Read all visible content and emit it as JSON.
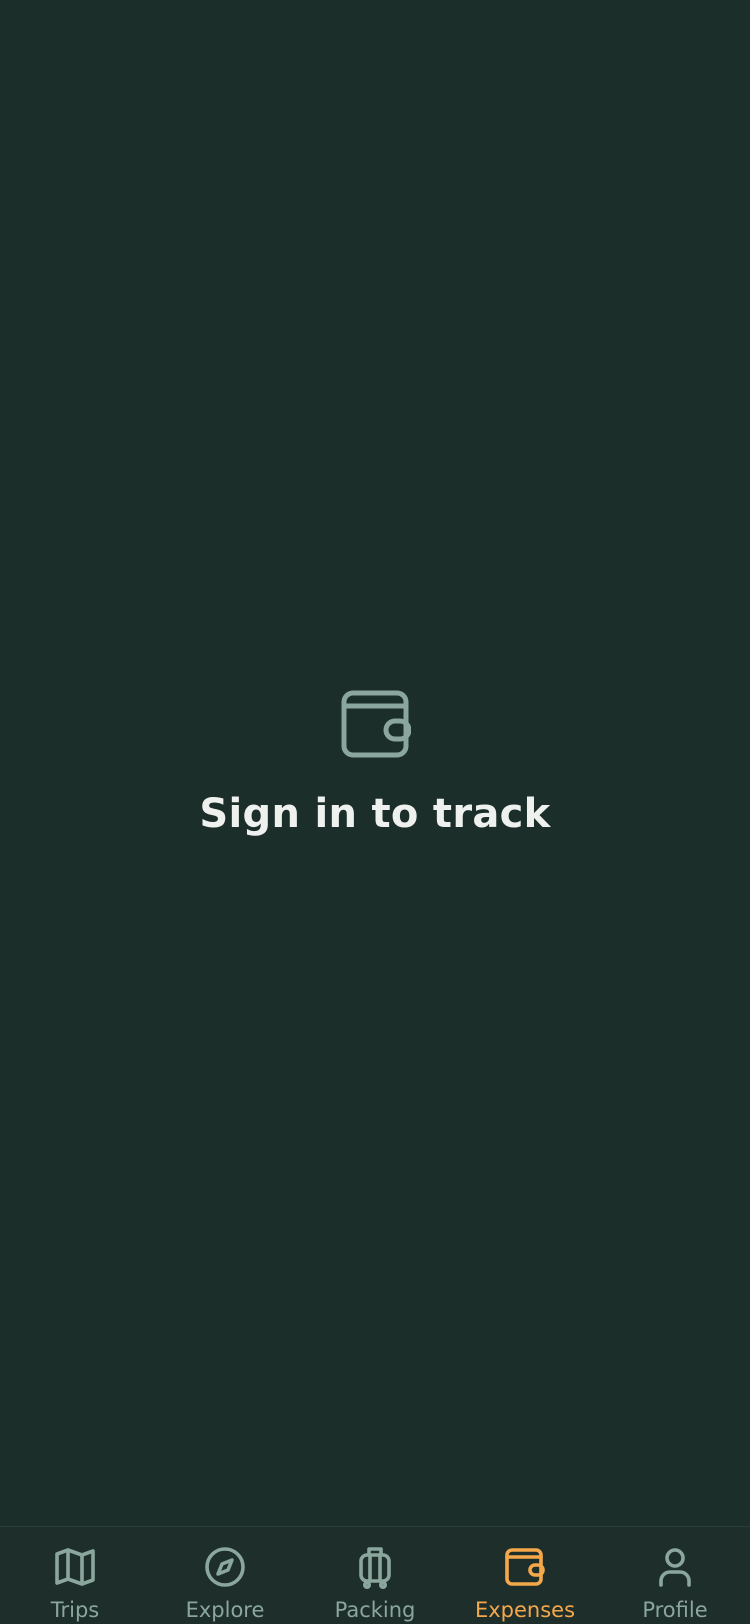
{
  "colors": {
    "background": "#1c2e2a",
    "tabbar_background": "#1e2e2b",
    "muted": "#8aa69d",
    "accent": "#f5a84a",
    "title": "#eef1ee"
  },
  "empty_state": {
    "icon": "wallet-icon",
    "title": "Sign in to track"
  },
  "tabbar": {
    "active": "expenses",
    "tabs": [
      {
        "id": "trips",
        "label": "Trips",
        "icon": "map-icon"
      },
      {
        "id": "explore",
        "label": "Explore",
        "icon": "compass-icon"
      },
      {
        "id": "packing",
        "label": "Packing",
        "icon": "luggage-icon"
      },
      {
        "id": "expenses",
        "label": "Expenses",
        "icon": "wallet-icon"
      },
      {
        "id": "profile",
        "label": "Profile",
        "icon": "user-icon"
      }
    ]
  }
}
